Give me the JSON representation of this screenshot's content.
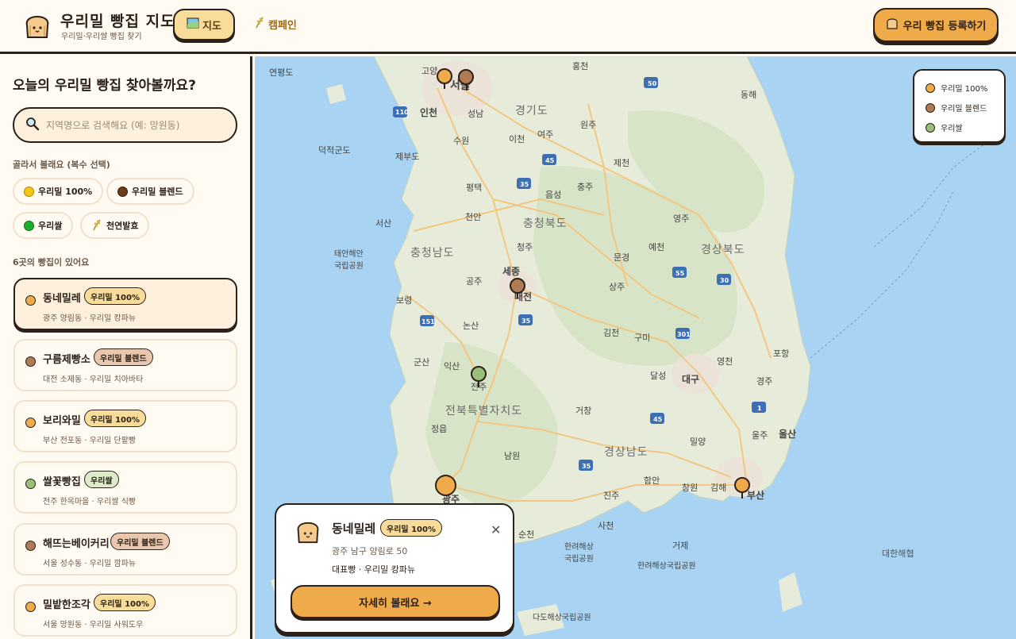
{
  "header": {
    "title": "우리밀 빵집 지도",
    "subtitle": "우리밀·우리쌀 빵집 찾기",
    "nav_map": "지도",
    "nav_campaign": "캠페인",
    "register_button": "우리 빵집 등록하기"
  },
  "sidebar": {
    "heading": "오늘의 우리밀 빵집 찾아볼까요?",
    "search_placeholder": "지역명으로 검색해요 (예: 망원동)",
    "filter_label": "골라서 볼래요 (복수 선택)",
    "filters": [
      {
        "label": "우리밀 100%",
        "color": "#f5c518"
      },
      {
        "label": "우리밀 블렌드",
        "color": "#6b3b1a"
      },
      {
        "label": "우리쌀",
        "color": "#1fae2b"
      },
      {
        "label": "천연발효",
        "color": ""
      }
    ],
    "count_label": "6곳의 빵집이 있어요",
    "bakeries": [
      {
        "name": "동네밀레",
        "badge": "우리밀 100%",
        "meta": "광주 양림동 · 우리밀 캉파뉴",
        "dot": "#efab4a",
        "badge_bg": "#f8dd9a"
      },
      {
        "name": "구름제빵소",
        "badge": "우리밀 블렌드",
        "meta": "대전 소제동 · 우리밀 치아바타",
        "dot": "#b07a55",
        "badge_bg": "#e9c7ae"
      },
      {
        "name": "보리와밀",
        "badge": "우리밀 100%",
        "meta": "부산 전포동 · 우리밀 단팥빵",
        "dot": "#efab4a",
        "badge_bg": "#f8dd9a"
      },
      {
        "name": "쌀꽃빵집",
        "badge": "우리쌀",
        "meta": "전주 한옥마을 · 우리쌀 식빵",
        "dot": "#9bbf7a",
        "badge_bg": "#dcebc8"
      },
      {
        "name": "해뜨는베이커리",
        "badge": "우리밀 블렌드",
        "meta": "서울 성수동 · 우리밀 깜파뉴",
        "dot": "#b07a55",
        "badge_bg": "#e9c7ae"
      },
      {
        "name": "밀밭한조각",
        "badge": "우리밀 100%",
        "meta": "서울 망원동 · 우리밀 사워도우",
        "dot": "#efab4a",
        "badge_bg": "#f8dd9a"
      }
    ]
  },
  "map": {
    "legend": [
      {
        "label": "우리밀 100%",
        "color": "#efab4a"
      },
      {
        "label": "우리밀 블렌드",
        "color": "#b07a55"
      },
      {
        "label": "우리쌀",
        "color": "#9bbf7a"
      }
    ],
    "place_labels": {
      "seoul": "서울",
      "incheon": "인천",
      "suwon": "수원",
      "icheon": "이천",
      "yeoju": "여주",
      "wonju": "원주",
      "pyeongtaek": "평택",
      "eumseong": "음성",
      "chungju": "충주",
      "jecheon": "제천",
      "cheonan": "천안",
      "cheongju": "청주",
      "sejong": "세종",
      "daejeon": "대전",
      "gongju": "공주",
      "boryeong": "보령",
      "seosan": "서산",
      "nonsan": "논산",
      "gunsan": "군산",
      "iksan": "익산",
      "jeonju": "전주",
      "jeongeup": "정읍",
      "namwon": "남원",
      "gwangju": "광주",
      "suncheon": "순천",
      "sacheon": "사천",
      "jinju": "진주",
      "geochang": "거창",
      "gimcheon": "김천",
      "gumi": "구미",
      "daegu": "대구",
      "sangju": "상주",
      "yeongju": "영주",
      "yecheon": "예천",
      "mungyeong": "문경",
      "andong": "",
      "pohang": "포항",
      "gyeongju": "경주",
      "ulsan": "울산",
      "ulju": "울주",
      "busan": "부산",
      "gimhae": "김해",
      "changwon": "창원",
      "haman": "함안",
      "miryang": "밀양",
      "geoje": "거제",
      "yeongcheon": "영천",
      "dalseong": "달성",
      "hongcheon": "홍천",
      "donghae": "동해",
      "yeonpyeong": "연평도",
      "deokjeok": "덕적군도",
      "jebu": "제부도",
      "seongnam": "성남",
      "goyang": "고양",
      "taean": "태안해안\n국립공원",
      "hallyeo": "한려해상\n국립공원",
      "hallyeo2": "한려해상국립공원",
      "dado": "다도해상국립공원",
      "korea_strait": "대한해협"
    },
    "provinces": {
      "gyeonggi": "경기도",
      "chungbuk": "충청북도",
      "chungnam": "충청남도",
      "gyeongbuk": "경상북도",
      "jeonbuk": "전북특별자치도",
      "gyeongnam": "경상남도"
    }
  },
  "popup": {
    "name": "동네밀레",
    "badge": "우리밀 100%",
    "address": "광주 남구 양림로 50",
    "representative": "대표빵 · 우리밀 캉파뉴",
    "detail_button": "자세히 볼래요 →"
  }
}
